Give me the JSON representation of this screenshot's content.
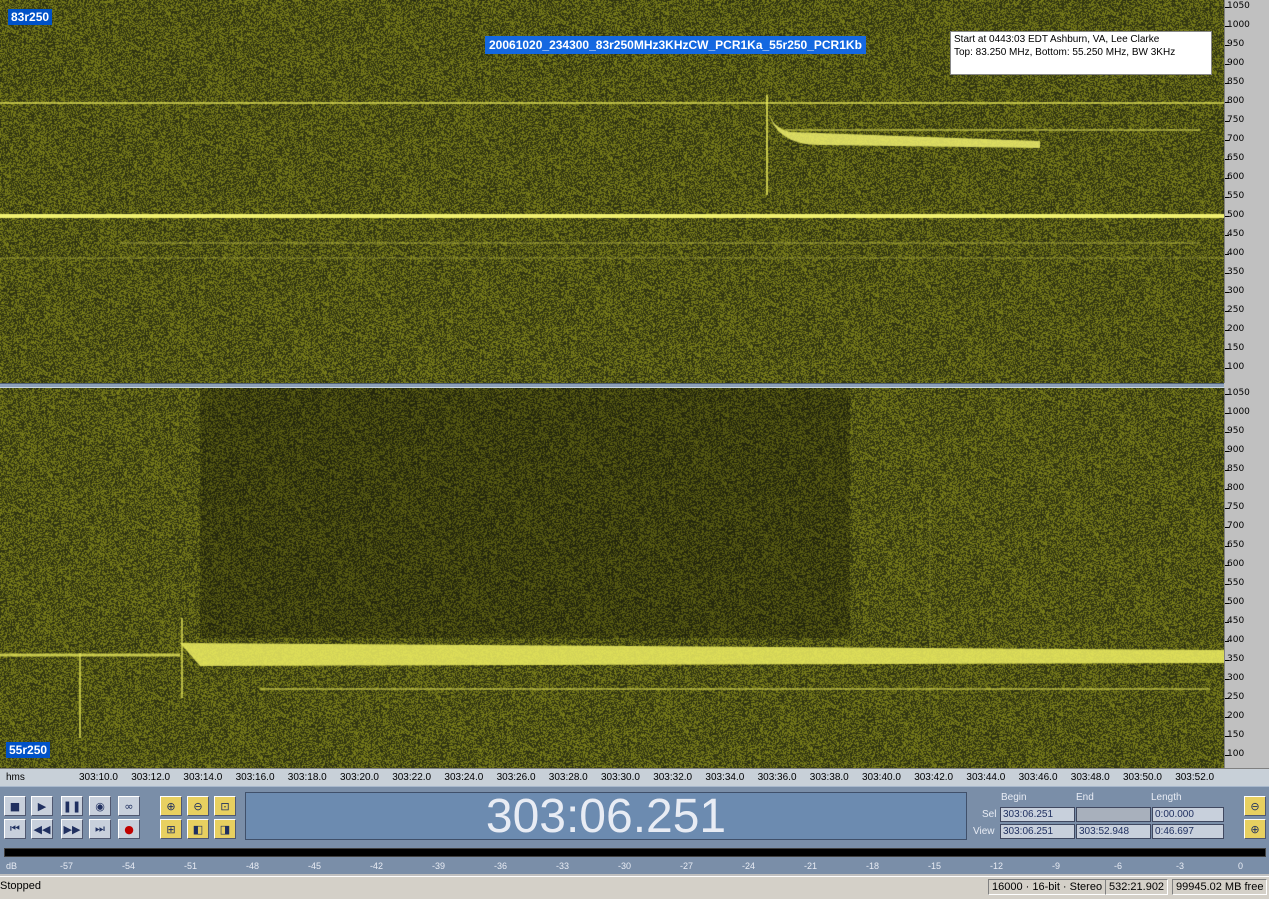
{
  "top_channel": {
    "label": "83r250",
    "file_title": "20061020_234300_83r250MHz3KHzCW_PCR1Ka_55r250_PCR1Kb",
    "note_line1": "Start at 0443:03 EDT Ashburn, VA, Lee Clarke",
    "note_line2": "Top: 83.250 MHz, Bottom: 55.250 MHz, BW 3KHz"
  },
  "bottom_channel": {
    "label": "55r250"
  },
  "freq_ticks": [
    "1050",
    "1000",
    "950",
    "900",
    "850",
    "800",
    "750",
    "700",
    "650",
    "600",
    "550",
    "500",
    "450",
    "400",
    "350",
    "300",
    "250",
    "200",
    "150",
    "100"
  ],
  "timeline": {
    "unit": "hms",
    "ticks": [
      "303:10.0",
      "303:12.0",
      "303:14.0",
      "303:16.0",
      "303:18.0",
      "303:20.0",
      "303:22.0",
      "303:24.0",
      "303:26.0",
      "303:28.0",
      "303:30.0",
      "303:32.0",
      "303:34.0",
      "303:36.0",
      "303:38.0",
      "303:40.0",
      "303:42.0",
      "303:44.0",
      "303:46.0",
      "303:48.0",
      "303:50.0",
      "303:52.0"
    ]
  },
  "transport": {
    "time_display": "303:06.251",
    "begin_header": "Begin",
    "end_header": "End",
    "length_header": "Length",
    "sel_label": "Sel",
    "view_label": "View",
    "sel_begin": "303:06.251",
    "sel_end": "",
    "sel_length": "0:00.000",
    "view_begin": "303:06.251",
    "view_end": "303:52.948",
    "view_length": "0:46.697"
  },
  "db_scale": {
    "unit": "dB",
    "ticks": [
      "-57",
      "-54",
      "-51",
      "-48",
      "-45",
      "-42",
      "-39",
      "-36",
      "-33",
      "-30",
      "-27",
      "-24",
      "-21",
      "-18",
      "-15",
      "-12",
      "-9",
      "-6",
      "-3",
      "0"
    ]
  },
  "status": {
    "state": "Stopped",
    "format": "16000 · 16-bit · Stereo",
    "total_time": "532:21.902",
    "free_space": "99945.02 MB free"
  },
  "colors": {
    "spectro_bg": "#3a3a16",
    "signal": "#f0f070",
    "panel": "#7a8ea8"
  }
}
